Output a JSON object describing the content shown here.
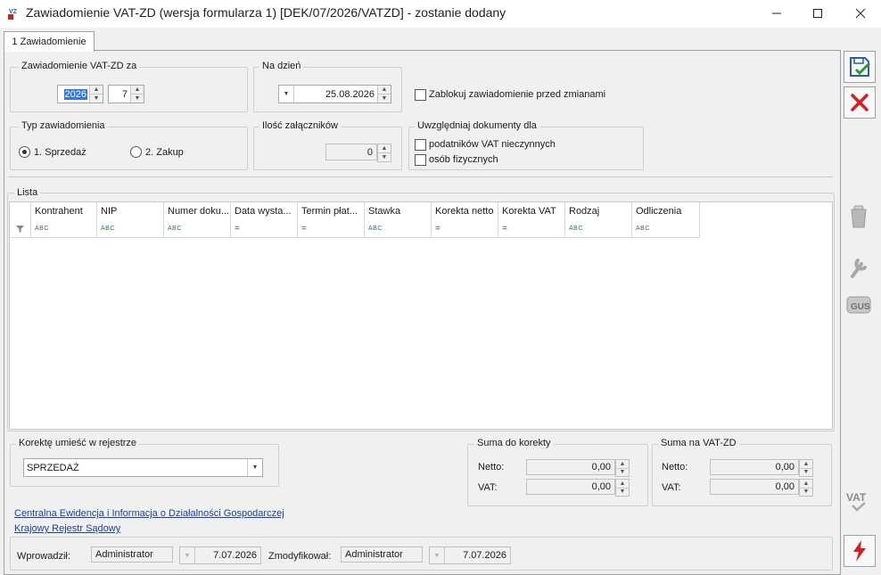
{
  "window": {
    "title": "Zawiadomienie VAT-ZD (wersja formularza 1) [DEK/07/2026/VATZD] - zostanie dodany",
    "icon_text": "VZ"
  },
  "tabs": [
    {
      "label": "1 Zawiadomienie"
    }
  ],
  "period": {
    "legend": "Zawiadomienie VAT-ZD za",
    "year": "2026",
    "month": "7"
  },
  "date": {
    "legend": "Na dzień",
    "value": "25.08.2026"
  },
  "lock": {
    "label": "Zablokuj zawiadomienie przed zmianami",
    "checked": false
  },
  "type": {
    "legend": "Typ zawiadomienia",
    "options": [
      {
        "label": "1. Sprzedaż",
        "selected": true
      },
      {
        "label": "2. Zakup",
        "selected": false
      }
    ]
  },
  "attachments": {
    "legend": "Ilość załączników",
    "value": "0"
  },
  "include": {
    "legend": "Uwzględniaj dokumenty dla",
    "options": [
      {
        "label": "podatników VAT nieczynnych",
        "checked": false
      },
      {
        "label": "osób fizycznych",
        "checked": false
      }
    ]
  },
  "list": {
    "legend": "Lista",
    "columns": [
      {
        "label": "Kontrahent",
        "filter": "abc"
      },
      {
        "label": "NIP",
        "filter": "abc"
      },
      {
        "label": "Numer doku...",
        "filter": "abc"
      },
      {
        "label": "Data wysta...",
        "filter": "eq"
      },
      {
        "label": "Termin płat...",
        "filter": "eq"
      },
      {
        "label": "Stawka",
        "filter": "abc"
      },
      {
        "label": "Korekta netto",
        "filter": "eq"
      },
      {
        "label": "Korekta VAT",
        "filter": "eq"
      },
      {
        "label": "Rodzaj",
        "filter": "abc"
      },
      {
        "label": "Odliczenia",
        "filter": "abc"
      }
    ],
    "filter_abc_text": "ABC",
    "filter_eq_text": "="
  },
  "register": {
    "legend": "Korektę umieść w rejestrze",
    "value": "SPRZEDAŻ"
  },
  "sum_correction": {
    "legend": "Suma do korekty",
    "netto_label": "Netto:",
    "netto": "0,00",
    "vat_label": "VAT:",
    "vat": "0,00"
  },
  "sum_vatzd": {
    "legend": "Suma na VAT-ZD",
    "netto_label": "Netto:",
    "netto": "0,00",
    "vat_label": "VAT:",
    "vat": "0,00"
  },
  "links": [
    {
      "label": "Centralna Ewidencja i Informacja o Działalności Gospodarczej"
    },
    {
      "label": "Krajowy Rejestr Sądowy"
    }
  ],
  "footer": {
    "entered_label": "Wprowadził:",
    "entered_user": "Administrator",
    "entered_date": "7.07.2026",
    "modified_label": "Zmodyfikował:",
    "modified_user": "Administrator",
    "modified_date": "7.07.2026"
  },
  "side_icons": {
    "gus_text": "GUS",
    "vat_text": "VAT"
  },
  "colors": {
    "accent_red": "#d42020",
    "accent_blue": "#2a5bb5",
    "link": "#1a3fa0"
  }
}
